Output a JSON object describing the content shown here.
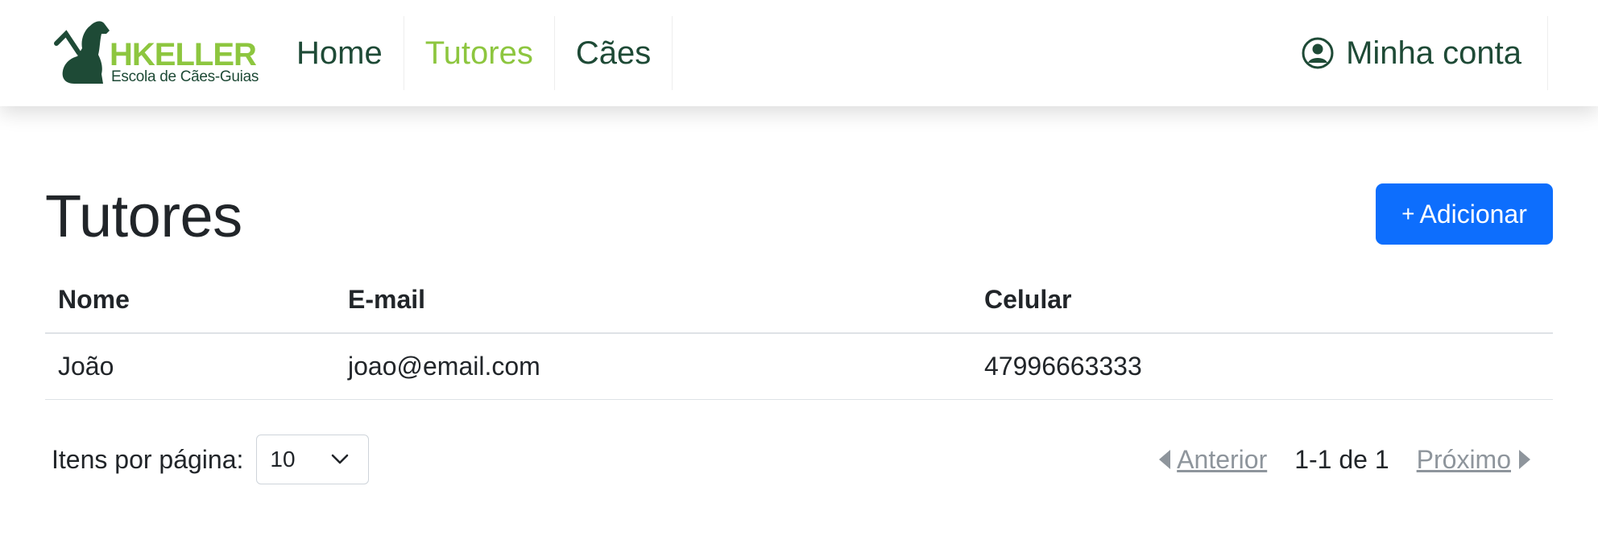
{
  "brand": {
    "name": "HKELLER",
    "subtitle": "Escola de Cães-Guias",
    "primary_color": "#1e4a36",
    "accent_color": "#8dc63f"
  },
  "nav": {
    "links": [
      {
        "label": "Home",
        "active": false
      },
      {
        "label": "Tutores",
        "active": true
      },
      {
        "label": "Cães",
        "active": false
      }
    ],
    "account": {
      "label": "Minha conta",
      "icon": "user-circle-icon"
    }
  },
  "page": {
    "title": "Tutores",
    "add_button": {
      "icon": "+",
      "label": "Adicionar",
      "color": "#0d6efd"
    }
  },
  "table": {
    "columns": [
      "Nome",
      "E-mail",
      "Celular"
    ],
    "rows": [
      [
        "João",
        "joao@email.com",
        "47996663333"
      ]
    ]
  },
  "pagination": {
    "per_page_label": "Itens por página:",
    "per_page_value": "10",
    "prev_label": "Anterior",
    "range_info": "1-1 de 1",
    "next_label": "Próximo"
  }
}
